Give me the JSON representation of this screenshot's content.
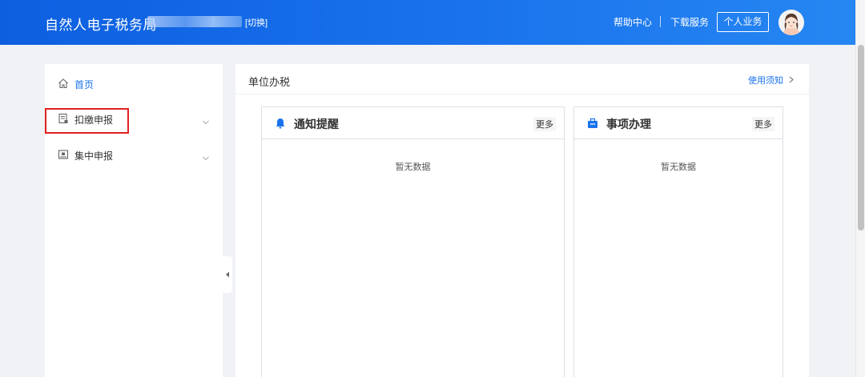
{
  "header": {
    "title": "自然人电子税务局",
    "switch_label": "[切换]",
    "help_label": "帮助中心",
    "download_label": "下载服务",
    "personal_button": "个人业务"
  },
  "sidebar": {
    "items": [
      {
        "label": "首页",
        "icon": "home-icon",
        "active": true
      },
      {
        "label": "扣缴申报",
        "icon": "form-icon",
        "expandable": true,
        "highlighted": true
      },
      {
        "label": "集中申报",
        "icon": "doc-icon",
        "expandable": true
      }
    ]
  },
  "main": {
    "title": "单位办税",
    "notice_link": "使用须知",
    "cards": [
      {
        "title": "通知提醒",
        "icon": "bell-icon",
        "more": "更多",
        "empty_text": "暂无数据"
      },
      {
        "title": "事项办理",
        "icon": "briefcase-icon",
        "more": "更多",
        "empty_text": "暂无数据"
      }
    ]
  },
  "colors": {
    "header_blue": "#1a73ec",
    "accent": "#1a73ec",
    "highlight_red": "#e02020"
  }
}
